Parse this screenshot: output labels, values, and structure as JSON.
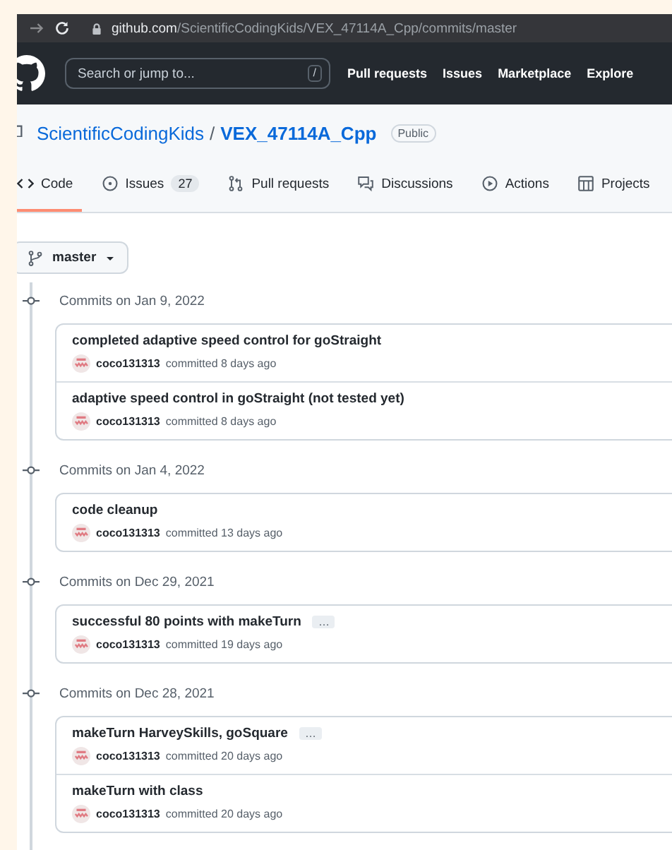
{
  "browser": {
    "url_host": "github.com",
    "url_path": "/ScientificCodingKids/VEX_47114A_Cpp/commits/master"
  },
  "header": {
    "search_placeholder": "Search or jump to...",
    "search_key": "/",
    "nav": [
      "Pull requests",
      "Issues",
      "Marketplace",
      "Explore"
    ]
  },
  "repo": {
    "owner": "ScientificCodingKids",
    "separator": "/",
    "name": "VEX_47114A_Cpp",
    "visibility": "Public"
  },
  "tabs": [
    {
      "kind": "code",
      "label": "Code",
      "selected": true
    },
    {
      "kind": "issues",
      "label": "Issues",
      "count": "27",
      "selected": false
    },
    {
      "kind": "pulls",
      "label": "Pull requests",
      "selected": false
    },
    {
      "kind": "discussions",
      "label": "Discussions",
      "selected": false
    },
    {
      "kind": "actions",
      "label": "Actions",
      "selected": false
    },
    {
      "kind": "projects",
      "label": "Projects",
      "selected": false
    }
  ],
  "branch": {
    "name": "master"
  },
  "groups": [
    {
      "heading": "Commits on Jan 9, 2022",
      "commits": [
        {
          "title": "completed adaptive speed control for goStraight",
          "author": "coco131313",
          "meta": "committed 8 days ago"
        },
        {
          "title": "adaptive speed control in goStraight (not tested yet)",
          "author": "coco131313",
          "meta": "committed 8 days ago"
        }
      ]
    },
    {
      "heading": "Commits on Jan 4, 2022",
      "commits": [
        {
          "title": "code cleanup",
          "author": "coco131313",
          "meta": "committed 13 days ago"
        }
      ]
    },
    {
      "heading": "Commits on Dec 29, 2021",
      "commits": [
        {
          "title": "successful 80 points with makeTurn",
          "more": "…",
          "author": "coco131313",
          "meta": "committed 19 days ago"
        }
      ]
    },
    {
      "heading": "Commits on Dec 28, 2021",
      "commits": [
        {
          "title": "makeTurn HarveySkills, goSquare",
          "more": "…",
          "author": "coco131313",
          "meta": "committed 20 days ago"
        },
        {
          "title": "makeTurn with class",
          "author": "coco131313",
          "meta": "committed 20 days ago"
        }
      ]
    }
  ]
}
